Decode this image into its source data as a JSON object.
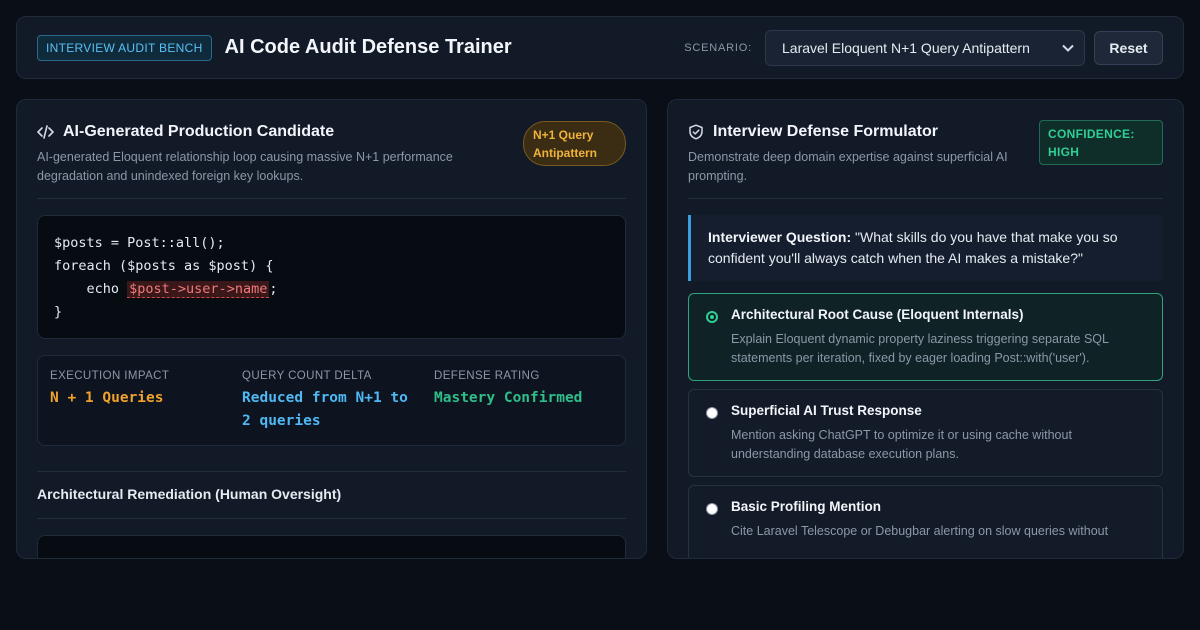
{
  "header": {
    "badge": "INTERVIEW AUDIT BENCH",
    "title": "AI Code Audit Defense Trainer",
    "scenario_label": "SCENARIO:",
    "scenario_selected": "Laravel Eloquent N+1 Query Antipattern",
    "reset_label": "Reset"
  },
  "candidate": {
    "icon": "code-icon",
    "title": "AI-Generated Production Candidate",
    "description": "AI-generated Eloquent relationship loop causing massive N+1 performance degradation and unindexed foreign key lookups.",
    "tag": "N+1 Query Antipattern",
    "code": {
      "line1": "$posts = Post::all();",
      "line2": "foreach ($posts as $post) {",
      "line3_prefix": "    echo ",
      "line3_highlight": "$post->user->name",
      "line3_suffix": ";",
      "line4": "}"
    },
    "metrics": [
      {
        "label": "EXECUTION IMPACT",
        "value": "N + 1 Queries",
        "color": "#f0a22e"
      },
      {
        "label": "QUERY COUNT DELTA",
        "value": "Reduced from N+1 to 2 queries",
        "color": "#4fb8f5"
      },
      {
        "label": "DEFENSE RATING",
        "value": "Mastery Confirmed",
        "color": "#2fbf8a"
      }
    ],
    "remediation_title": "Architectural Remediation (Human Oversight)"
  },
  "defense": {
    "icon": "shield-check-icon",
    "title": "Interview Defense Formulator",
    "description": "Demonstrate deep domain expertise against superficial AI prompting.",
    "confidence": "CONFIDENCE: HIGH",
    "question_label": "Interviewer Question:",
    "question_text": "\"What skills do you have that make you so confident you'll always catch when the AI makes a mistake?\"",
    "options": [
      {
        "title": "Architectural Root Cause (Eloquent Internals)",
        "description": "Explain Eloquent dynamic property laziness triggering separate SQL statements per iteration, fixed by eager loading Post::with('user').",
        "selected": true
      },
      {
        "title": "Superficial AI Trust Response",
        "description": "Mention asking ChatGPT to optimize it or using cache without understanding database execution plans.",
        "selected": false
      },
      {
        "title": "Basic Profiling Mention",
        "description": "Cite Laravel Telescope or Debugbar alerting on slow queries without",
        "selected": false
      }
    ]
  },
  "colors": {
    "accent_blue": "#3b9fe0",
    "accent_green": "#2fcf95",
    "accent_orange": "#f0b23a",
    "danger": "#f07a7a"
  }
}
